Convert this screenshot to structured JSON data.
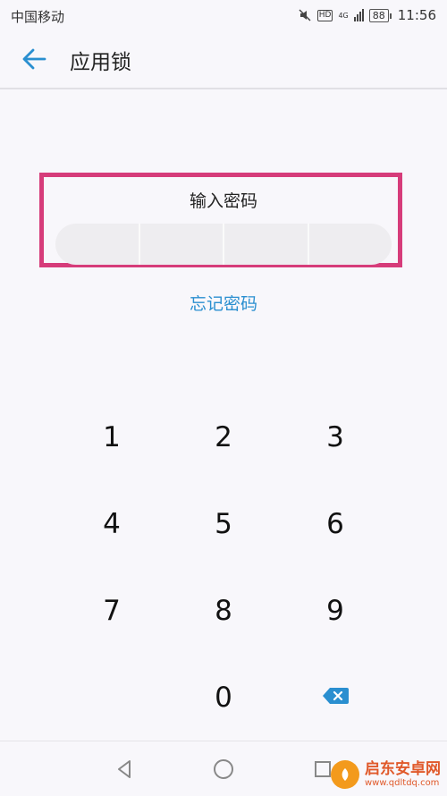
{
  "status_bar": {
    "carrier": "中国移动",
    "network": "4G",
    "hd": "HD",
    "battery": "88",
    "time": "11:56"
  },
  "header": {
    "title": "应用锁"
  },
  "pin": {
    "label": "输入密码",
    "forgot": "忘记密码"
  },
  "keypad": {
    "k1": "1",
    "k2": "2",
    "k3": "3",
    "k4": "4",
    "k5": "5",
    "k6": "6",
    "k7": "7",
    "k8": "8",
    "k9": "9",
    "k0": "0"
  },
  "watermark": {
    "name": "启东安卓网",
    "url": "www.qdltdq.com"
  },
  "colors": {
    "accent": "#2a8fd0",
    "highlight": "#d63c7a"
  },
  "icons": {
    "back": "arrow-left-icon",
    "delete": "backspace-icon",
    "nav_back": "triangle-back-icon",
    "nav_home": "circle-home-icon",
    "nav_recent": "square-recent-icon"
  }
}
